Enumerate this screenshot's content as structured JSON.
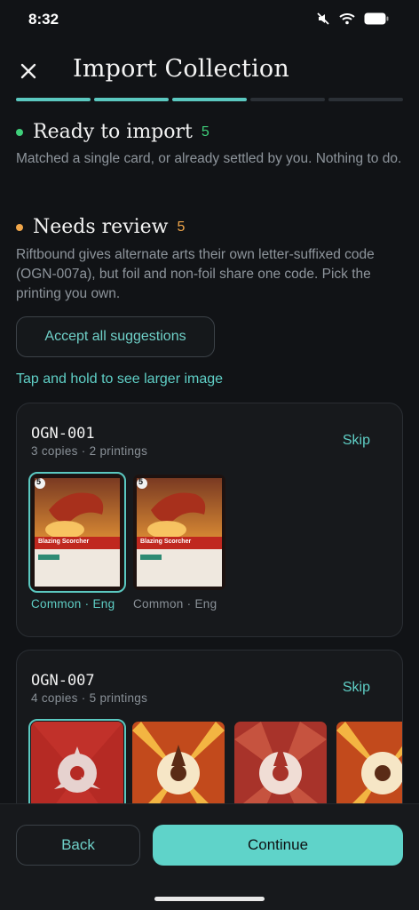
{
  "status_bar": {
    "time": "8:32"
  },
  "header": {
    "title": "Import Collection"
  },
  "progress": {
    "total_steps": 5,
    "completed_steps": 3
  },
  "sections": {
    "ready": {
      "title": "Ready to import",
      "count": "5",
      "description": "Matched a single card, or already settled by you. Nothing to do.",
      "dot_color": "#3fcf7a"
    },
    "review": {
      "title": "Needs review",
      "count": "5",
      "description": "Riftbound gives alternate arts their own letter-suffixed code (OGN-007a), but foil and non-foil share one code. Pick the printing you own.",
      "dot_color": "#f0a64a"
    }
  },
  "accept_all_label": "Accept all suggestions",
  "hint": "Tap and hold to see larger image",
  "groups": [
    {
      "code": "OGN-001",
      "meta": "3 copies · 2 printings",
      "skip_label": "Skip",
      "printings": [
        {
          "card_name": "Blazing Scorcher",
          "card_cost": "5",
          "label": "Common · Eng",
          "selected": true
        },
        {
          "card_name": "Blazing Scorcher",
          "card_cost": "5",
          "label": "Common · Eng",
          "selected": false
        }
      ]
    },
    {
      "code": "OGN-007",
      "meta": "4 copies · 5 printings",
      "skip_label": "Skip",
      "printings": [
        {
          "selected": true
        },
        {
          "selected": false
        },
        {
          "selected": false
        },
        {
          "selected": false
        }
      ]
    }
  ],
  "footer": {
    "back_label": "Back",
    "continue_label": "Continue"
  },
  "colors": {
    "accent": "#5fd3c9",
    "background": "#111316",
    "card_surface": "#17191c"
  }
}
